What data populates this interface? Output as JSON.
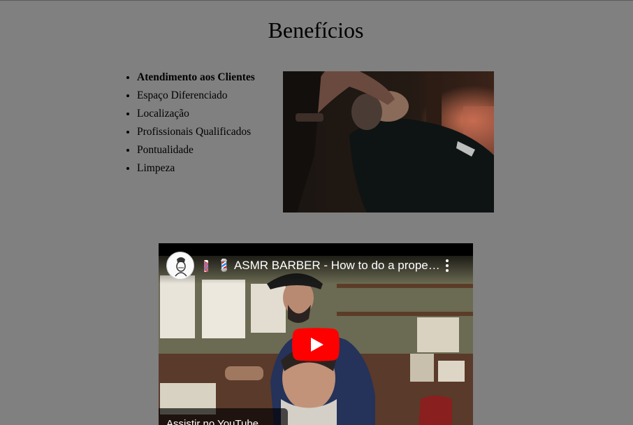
{
  "page": {
    "title": "Benefícios"
  },
  "benefits": [
    "Atendimento aos Clientes",
    "Espaço Diferenciado",
    "Localização",
    "Profissionais Qualificados",
    "Pontualidade",
    "Limpeza"
  ],
  "video": {
    "title": "💈 ASMR BARBER - How to do a proper ...",
    "watch_on": "Assistir no YouTube",
    "colors": {
      "play": "#ff0000",
      "overlay": "#000000"
    }
  },
  "icons": {
    "play": "play-icon",
    "menu": "more-vert-icon",
    "pole": "barber-pole-icon"
  }
}
